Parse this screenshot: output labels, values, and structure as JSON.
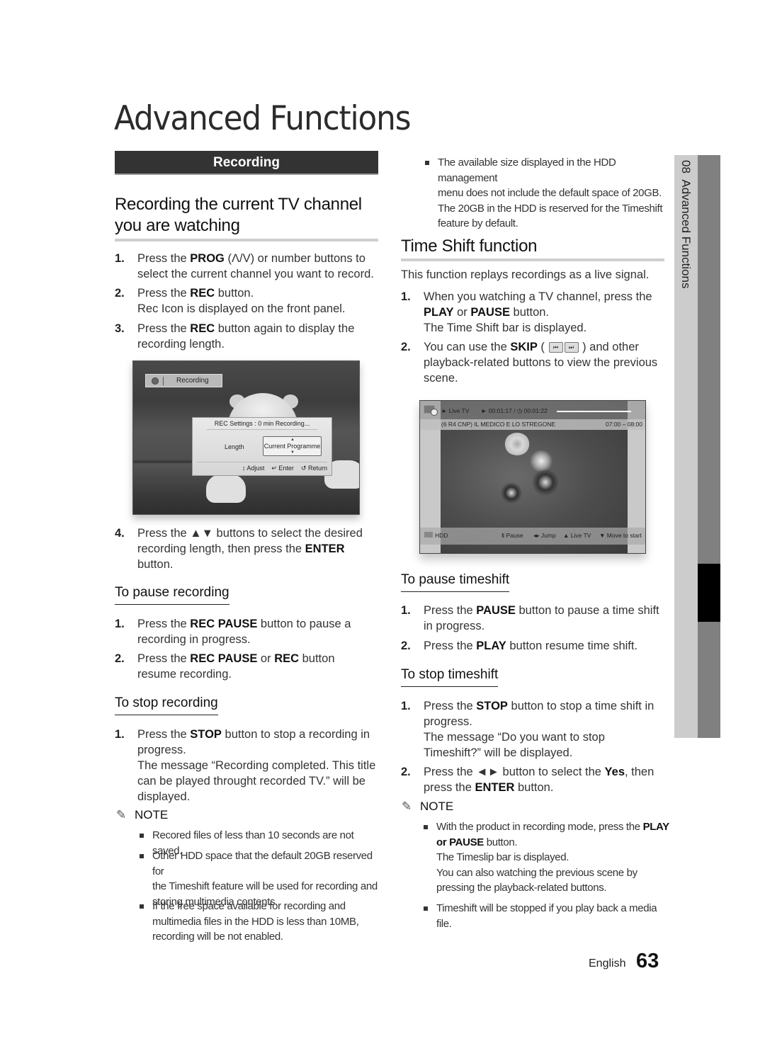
{
  "page": {
    "title": "Advanced Functions",
    "section_bar": "Recording",
    "side_tab": "08  Advanced Functions",
    "footer_language": "English",
    "footer_page_number": "63"
  },
  "left": {
    "heading": "Recording the current TV channel you are watching",
    "heading_line1": "Recording the current TV channel",
    "heading_line2": "you are watching",
    "steps": [
      {
        "num": "1.",
        "pre": "Press the ",
        "b1": "PROG",
        "mid": " (Λ/V) or number buttons to",
        "line2": "select the current channel you want to record."
      },
      {
        "num": "2.",
        "pre": "Press the ",
        "b1": "REC",
        "mid": " button.",
        "line2": "Rec Icon is displayed on the front panel."
      },
      {
        "num": "3.",
        "pre": "Press the ",
        "b1": "REC",
        "mid": " button again to display the",
        "line2": "recording length."
      },
      {
        "num": "4.",
        "pre": "Press the ▲▼ buttons to select the desired",
        "line2_pre": "recording length, then press the ",
        "line2_b": "ENTER",
        "line3": "button."
      }
    ],
    "screenshot": {
      "badge_label": "Recording",
      "dialog_title": "REC Settings : 0 min Recording...",
      "length_label": "Length",
      "length_value": "Current Programme",
      "hint_adjust": "↕ Adjust",
      "hint_enter": "↵ Enter",
      "hint_return": "↺ Return"
    },
    "pause": {
      "heading": "To pause recording",
      "steps": [
        {
          "num": "1.",
          "pre": "Press the ",
          "b1": "REC PAUSE",
          "mid": " button to pause a",
          "line2": "recording in progress."
        },
        {
          "num": "2.",
          "pre": "Press the ",
          "b1": "REC PAUSE",
          "mid": " or ",
          "b2": "REC",
          "post": " button",
          "line2": "resume recording."
        }
      ]
    },
    "stop": {
      "heading": "To stop recording",
      "steps": [
        {
          "num": "1.",
          "pre": "Press the ",
          "b1": "STOP",
          "mid": " button to stop a recording in",
          "line2": "progress.",
          "line3": "The message “Recording completed. This title",
          "line4": "can be played throught recorded TV.” will be",
          "line5": "displayed."
        }
      ]
    },
    "note": {
      "label": "NOTE",
      "items": [
        {
          "lines": [
            "Recored files of less than 10 seconds are not saved."
          ]
        },
        {
          "lines": [
            "Other HDD space that the default 20GB reserved for",
            "the Timeshift feature will be used for recording and",
            "storing multimedia contents."
          ]
        },
        {
          "lines": [
            "If the free space available for recording and",
            "multimedia files in the HDD is less than 10MB,",
            "recording will be not enabled."
          ]
        }
      ]
    }
  },
  "right": {
    "top_note": [
      "The available size displayed in the HDD management",
      "menu does not include the default space of 20GB.",
      "The 20GB in the HDD is reserved for the Timeshift",
      "feature by default."
    ],
    "heading": "Time Shift function",
    "intro": "This function replays recordings as a live signal.",
    "steps": [
      {
        "num": "1.",
        "line1": "When you watching a TV channel, press the",
        "l2_b1": "PLAY",
        "l2_mid": " or ",
        "l2_b2": "PAUSE",
        "l2_post": " button.",
        "line3": "The Time Shift bar is displayed."
      },
      {
        "num": "2.",
        "pre": "You can use the ",
        "b1": "SKIP",
        "mid": " ( ",
        "skip_prev": "⏮",
        "skip_next": "⏭",
        "post": " ) and other",
        "line2": "playback-related buttons to view the previous",
        "line3": "scene."
      }
    ],
    "screenshot": {
      "mode": "► Live TV",
      "time": "► 00:01:17 / ◷ 00:01:22",
      "progress": 0.95,
      "channel": "(6 R4 CNP)  IL MEDICO E LO STREGONE",
      "time_range": "07:00 – 08:00",
      "storage": "HDD",
      "hint_pause": "Ⅱ Pause",
      "hint_jump": "◂▸ Jump",
      "hint_live": "▲ Live TV",
      "hint_start": "▼ Move to start"
    },
    "pause": {
      "heading": "To pause timeshift",
      "steps": [
        {
          "num": "1.",
          "pre": "Press the ",
          "b1": "PAUSE",
          "mid": " button to pause a time shift",
          "line2": "in progress."
        },
        {
          "num": "2.",
          "pre": "Press the ",
          "b1": "PLAY",
          "mid": " button resume time shift."
        }
      ]
    },
    "stop": {
      "heading": "To stop timeshift",
      "steps": [
        {
          "num": "1.",
          "pre": "Press the ",
          "b1": "STOP",
          "mid": " button to stop a time shift in",
          "line2": "progress.",
          "line3": "The message “Do you want to stop",
          "line4": "Timeshift?” will be displayed."
        },
        {
          "num": "2.",
          "pre": "Press the ◄► button to select the ",
          "b1": "Yes",
          "mid": ", then",
          "l2_pre": "press the ",
          "l2_b": "ENTER",
          "l2_post": " button."
        }
      ]
    },
    "note": {
      "label": "NOTE",
      "items": [
        {
          "l1_pre": "With the product in recording mode, press the ",
          "l1_b": "PLAY",
          "l2_b": "or PAUSE",
          "l2_post": " button.",
          "l3": "The Timeslip bar is displayed.",
          "l4": "You can also watching the previous scene by",
          "l5": "pressing the playback-related buttons."
        },
        {
          "lines": [
            "Timeshift will be stopped if you play back a media",
            "file."
          ]
        }
      ]
    }
  }
}
